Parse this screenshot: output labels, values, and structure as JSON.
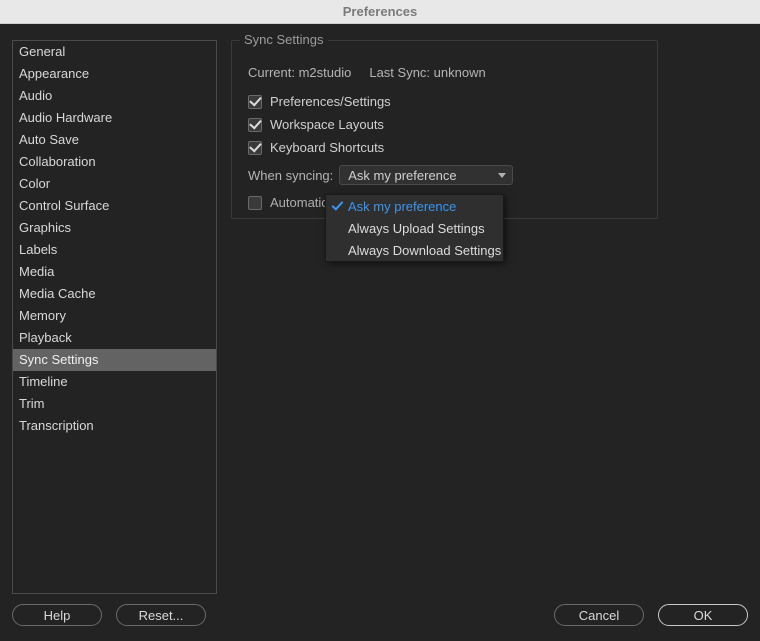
{
  "window": {
    "title": "Preferences"
  },
  "sidebar": {
    "items": [
      {
        "label": "General"
      },
      {
        "label": "Appearance"
      },
      {
        "label": "Audio"
      },
      {
        "label": "Audio Hardware"
      },
      {
        "label": "Auto Save"
      },
      {
        "label": "Collaboration"
      },
      {
        "label": "Color"
      },
      {
        "label": "Control Surface"
      },
      {
        "label": "Graphics"
      },
      {
        "label": "Labels"
      },
      {
        "label": "Media"
      },
      {
        "label": "Media Cache"
      },
      {
        "label": "Memory"
      },
      {
        "label": "Playback"
      },
      {
        "label": "Sync Settings",
        "selected": true
      },
      {
        "label": "Timeline"
      },
      {
        "label": "Trim"
      },
      {
        "label": "Transcription"
      }
    ]
  },
  "panel": {
    "title": "Sync Settings",
    "current_label": "Current:",
    "current_value": "m2studio",
    "last_sync_label": "Last Sync:",
    "last_sync_value": "unknown",
    "checkboxes": {
      "preferences_settings": {
        "label": "Preferences/Settings",
        "checked": true
      },
      "workspace_layouts": {
        "label": "Workspace Layouts",
        "checked": true
      },
      "keyboard_shortcuts": {
        "label": "Keyboard Shortcuts",
        "checked": true
      },
      "auto_clear": {
        "label": "Automaticall",
        "checked": false
      }
    },
    "when_syncing": {
      "label": "When syncing:",
      "selected": "Ask my preference",
      "options": [
        "Ask my preference",
        "Always Upload Settings",
        "Always Download Settings"
      ]
    }
  },
  "buttons": {
    "help": "Help",
    "reset": "Reset...",
    "cancel": "Cancel",
    "ok": "OK"
  }
}
